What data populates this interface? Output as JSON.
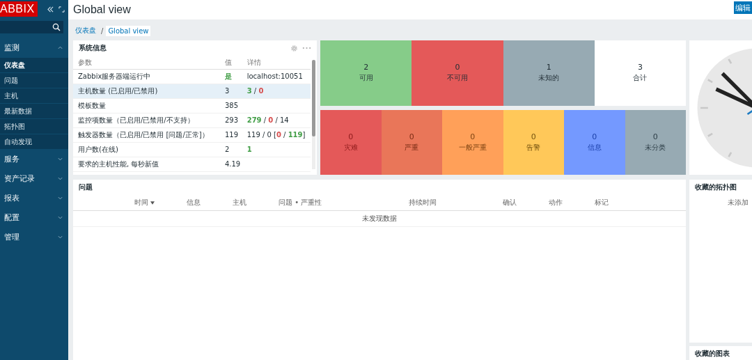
{
  "logo": "ABBIX",
  "sidebar": {
    "menu": [
      {
        "label": "监测",
        "expanded": true,
        "children": [
          {
            "label": "仪表盘",
            "selected": true
          },
          {
            "label": "问题",
            "selected": false
          },
          {
            "label": "主机",
            "selected": false
          },
          {
            "label": "最新数据",
            "selected": false
          },
          {
            "label": "拓扑图",
            "selected": false
          },
          {
            "label": "自动发现",
            "selected": false
          }
        ]
      },
      {
        "label": "服务",
        "expanded": false
      },
      {
        "label": "资产记录",
        "expanded": false
      },
      {
        "label": "报表",
        "expanded": false
      },
      {
        "label": "配置",
        "expanded": false
      },
      {
        "label": "管理",
        "expanded": false
      }
    ]
  },
  "header": {
    "title": "Global view",
    "edit_button": "编辑"
  },
  "breadcrumbs": {
    "separator": "/",
    "items": [
      {
        "label": "仪表盘",
        "selected": false
      },
      {
        "label": "Global view",
        "selected": true
      }
    ]
  },
  "system_info": {
    "title": "系统信息",
    "columns": [
      "参数",
      "值",
      "详情"
    ],
    "rows": [
      {
        "parameter": "Zabbix服务器端运行中",
        "value": {
          "text": "是",
          "color": "#429e47"
        },
        "details": [
          {
            "text": "localhost:10051"
          }
        ],
        "selected": false
      },
      {
        "parameter": "主机数量 (已启用/已禁用)",
        "value": {
          "text": "3"
        },
        "details": [
          {
            "text": "3",
            "color": "#429e47"
          },
          {
            "text": " / "
          },
          {
            "text": "0",
            "color": "#d64e4e"
          }
        ],
        "selected": true
      },
      {
        "parameter": "模板数量",
        "value": {
          "text": "385"
        },
        "selected": false
      },
      {
        "parameter": "监控项数量（已启用/已禁用/不支持）",
        "value": {
          "text": "293"
        },
        "details": [
          {
            "text": "279",
            "color": "#429e47"
          },
          {
            "text": " / "
          },
          {
            "text": "0",
            "color": "#d64e4e"
          },
          {
            "text": " / 14"
          }
        ],
        "selected": false
      },
      {
        "parameter": "触发器数量（已启用/已禁用 [问题/正常]）",
        "value": {
          "text": "119"
        },
        "details": [
          {
            "text": "119 / 0 ["
          },
          {
            "text": "0",
            "color": "#d64e4e"
          },
          {
            "text": " / "
          },
          {
            "text": "119",
            "color": "#429e47"
          },
          {
            "text": "]"
          }
        ],
        "selected": false
      },
      {
        "parameter": "用户数(在线)",
        "value": {
          "text": "2"
        },
        "details": [
          {
            "text": "1",
            "color": "#429e47"
          }
        ],
        "selected": false
      },
      {
        "parameter": "要求的主机性能, 每秒新值",
        "value": {
          "text": "4.19"
        },
        "selected": false
      }
    ]
  },
  "host_availability": [
    {
      "count": "2",
      "label": "可用",
      "kind": "available"
    },
    {
      "count": "0",
      "label": "不可用",
      "kind": "unavailable"
    },
    {
      "count": "1",
      "label": "未知的",
      "kind": "unknown"
    },
    {
      "count": "3",
      "label": "合计",
      "kind": "total"
    }
  ],
  "problems_by_severity": [
    {
      "count": "0",
      "label": "灾难",
      "kind": "disaster"
    },
    {
      "count": "0",
      "label": "严重",
      "kind": "high"
    },
    {
      "count": "0",
      "label": "一般严重",
      "kind": "average"
    },
    {
      "count": "0",
      "label": "告警",
      "kind": "warning"
    },
    {
      "count": "0",
      "label": "信息",
      "kind": "information"
    },
    {
      "count": "0",
      "label": "未分类",
      "kind": "unclassified"
    }
  ],
  "problems": {
    "title": "问题",
    "columns": [
      {
        "label": "时间",
        "sorted": true
      },
      {
        "label": "信息",
        "sorted": false
      },
      {
        "label": "主机",
        "sorted": false
      },
      {
        "label": "问题 • 严重性",
        "sorted": false
      },
      {
        "label": "持续时间",
        "sorted": false
      },
      {
        "label": "确认",
        "sorted": false
      },
      {
        "label": "动作",
        "sorted": false
      },
      {
        "label": "标记",
        "sorted": false
      }
    ],
    "empty_message": "未发现数据"
  },
  "favorite_maps": {
    "title": "收藏的拓扑图",
    "empty_message": "未添加"
  },
  "favorite_graphs": {
    "title": "收藏的图表"
  }
}
